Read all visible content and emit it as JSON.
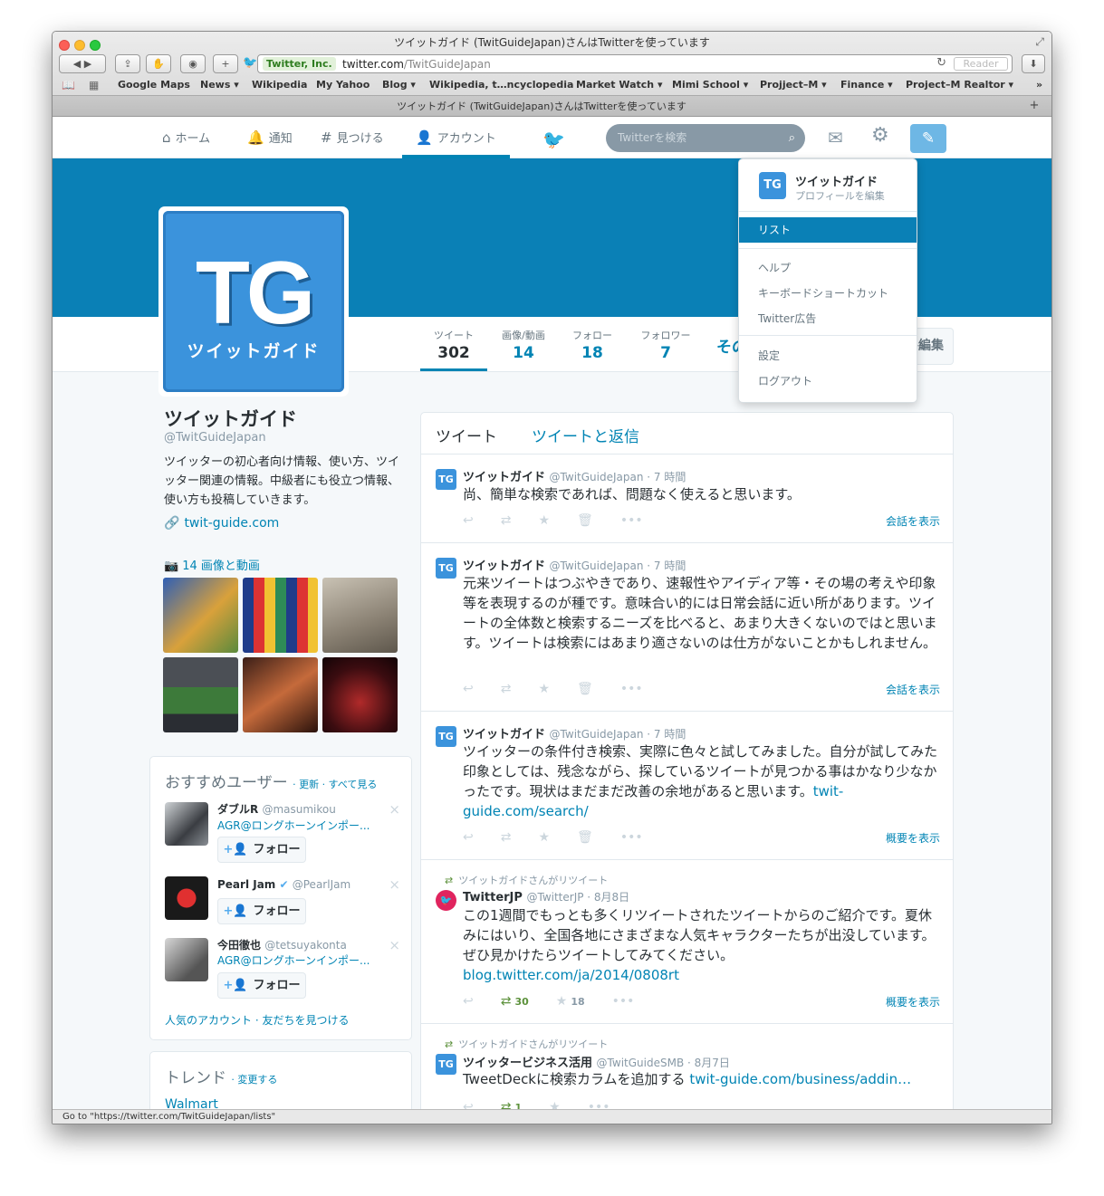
{
  "window": {
    "title": "ツイットガイド (TwitGuideJapan)さんはTwitterを使っています",
    "ev_label": "Twitter, Inc.",
    "url_host": "twitter.com",
    "url_path": "/TwitGuideJapan",
    "reader": "Reader",
    "status": "Go to \"https://twitter.com/TwitGuideJapan/lists\""
  },
  "bookmarks": [
    "Google Maps",
    "News ▾",
    "Wikipedia",
    "My Yahoo",
    "Blog ▾",
    "Wikipedia, t…ncyclopedia",
    "Market Watch ▾",
    "Mimi School ▾",
    "Projject–M ▾",
    "Finance ▾",
    "Project–M Realtor ▾"
  ],
  "tab": {
    "title": "ツイットガイド (TwitGuideJapan)さんはTwitterを使っています"
  },
  "nav": {
    "home": "ホーム",
    "notifications": "通知",
    "discover": "見つける",
    "account": "アカウント",
    "search_placeholder": "Twitterを検索"
  },
  "stats": [
    {
      "label": "ツイート",
      "value": "302"
    },
    {
      "label": "画像/動画",
      "value": "14"
    },
    {
      "label": "フォロー",
      "value": "18"
    },
    {
      "label": "フォロワー",
      "value": "7"
    },
    {
      "label": "",
      "value": "その"
    }
  ],
  "edit_profile": "ロフィール編集",
  "profile": {
    "avatar_text": "TG",
    "avatar_sub": "ツイットガイド",
    "name": "ツイットガイド",
    "handle": "@TwitGuideJapan",
    "bio": "ツイッターの初心者向け情報、使い方、ツイッター関連の情報。中級者にも役立つ情報、使い方も投稿していきます。",
    "url": "twit-guide.com",
    "photos_header": "14 画像と動画"
  },
  "who_to_follow": {
    "title": "おすすめユーザー",
    "actions": "· 更新 · すべて見る",
    "follow_label": "フォロー",
    "users": [
      {
        "name": "ダブルR",
        "handle": "@masumikou",
        "sub": "AGR@ロングホーンインポー..."
      },
      {
        "name": "Pearl Jam",
        "handle": "@PearlJam",
        "sub": ""
      },
      {
        "name": "今田徹也",
        "handle": "@tetsuyakonta",
        "sub": "AGR@ロングホーンインポー..."
      }
    ],
    "footer": "人気のアカウント · 友だちを見つける"
  },
  "trends": {
    "title": "トレンド",
    "action": "· 変更する",
    "first": "Walmart"
  },
  "stream_tabs": {
    "tweets": "ツイート",
    "replies": "ツイートと返信"
  },
  "tweets": [
    {
      "name": "ツイットガイド",
      "meta": "@TwitGuideJapan · 7 時間",
      "text": "尚、簡単な検索であれば、問題なく使えると思います。",
      "more": "会話を表示"
    },
    {
      "name": "ツイットガイド",
      "meta": "@TwitGuideJapan · 7 時間",
      "text": "元来ツイートはつぶやきであり、速報性やアイディア等・その場の考えや印象等を表現するのが種です。意味合い的には日常会話に近い所があります。ツイートの全体数と検索するニーズを比べると、あまり大きくないのではと思います。ツイートは検索にはあまり適さないのは仕方がないことかもしれません。",
      "more": "会話を表示"
    },
    {
      "name": "ツイットガイド",
      "meta": "@TwitGuideJapan · 7 時間",
      "text": "ツイッターの条件付き検索、実際に色々と試してみました。自分が試してみた印象としては、残念ながら、探しているツイートが見つかる事はかなり少なかったです。現状はまだまだ改善の余地があると思います。",
      "link": "twit-guide.com/search/",
      "more": "概要を表示"
    },
    {
      "context": "ツイットガイドさんがリツイート",
      "name": "TwitterJP",
      "meta": "@TwitterJP · 8月8日",
      "text": "この1週間でもっとも多くリツイートされたツイートからのご紹介です。夏休みにはいり、全国各地にさまざまな人気キャラクターたちが出没しています。ぜひ見かけたらツイートしてみてください。",
      "link": "blog.twitter.com/ja/2014/0808rt",
      "retweets": "30",
      "favorites": "18",
      "more": "概要を表示"
    },
    {
      "context": "ツイットガイドさんがリツイート",
      "name": "ツイッタービジネス活用",
      "meta": "@TwitGuideSMB · 8月7日",
      "text": "TweetDeckに検索カラムを追加する",
      "link": "twit-guide.com/business/addin…",
      "retweets": "1"
    }
  ],
  "dropdown": {
    "name": "ツイットガイド",
    "sub": "プロフィールを編集",
    "selected": "リスト",
    "items": [
      "ヘルプ",
      "キーボードショートカット",
      "Twitter広告",
      "設定",
      "ログアウト"
    ]
  },
  "colors": {
    "accent": "#0084b4",
    "banner": "#0a80b6",
    "avatar": "#3b93dc",
    "retweet": "#5c913b"
  }
}
